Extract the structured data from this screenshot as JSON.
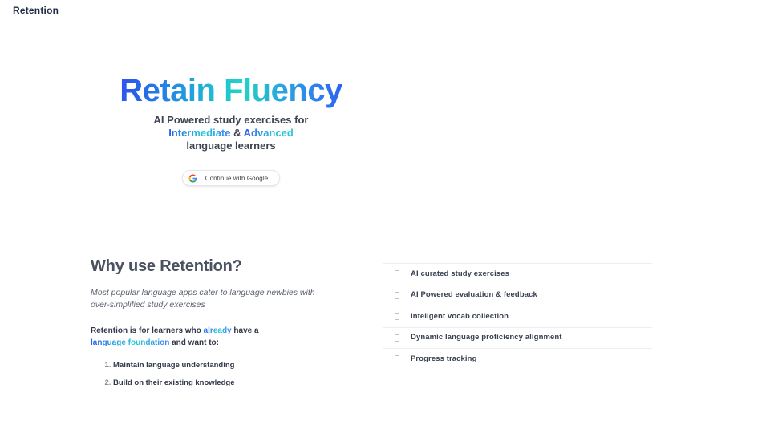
{
  "header": {
    "brand": "Retention"
  },
  "hero": {
    "title": "Retain Fluency",
    "subtitle_line1": "AI Powered study exercises for",
    "subtitle_highlight1": "Intermediate",
    "subtitle_conjunction": "&",
    "subtitle_highlight2": "Advanced",
    "subtitle_line3": "language learners",
    "google_button_label": "Continue with Google",
    "google_icon": "google-g-icon"
  },
  "why": {
    "heading": "Why use Retention?",
    "intro": "Most popular language apps cater to language newbies with over-simplified study exercises",
    "lead_part1": "Retention is for learners who",
    "lead_highlight1": "already",
    "lead_part2": "have a",
    "lead_highlight2": "language foundation",
    "lead_part3": "and want to:",
    "items": [
      "Maintain language understanding",
      "Build on their existing knowledge"
    ]
  },
  "features": {
    "items": [
      {
        "icon": "missing-glyph-icon",
        "label": "AI curated study exercises"
      },
      {
        "icon": "missing-glyph-icon",
        "label": "AI Powered evaluation & feedback"
      },
      {
        "icon": "missing-glyph-icon",
        "label": "Inteligent vocab collection"
      },
      {
        "icon": "missing-glyph-icon",
        "label": "Dynamic language proficiency alignment"
      },
      {
        "icon": "missing-glyph-icon",
        "label": "Progress tracking"
      }
    ]
  },
  "colors": {
    "gradient_start": "#5b21f0",
    "gradient_mid": "#22d3c5",
    "gradient_end": "#2323f0",
    "heading": "#4a5160",
    "body": "#5c6270",
    "divider": "#eceef1",
    "background": "#ffffff"
  }
}
